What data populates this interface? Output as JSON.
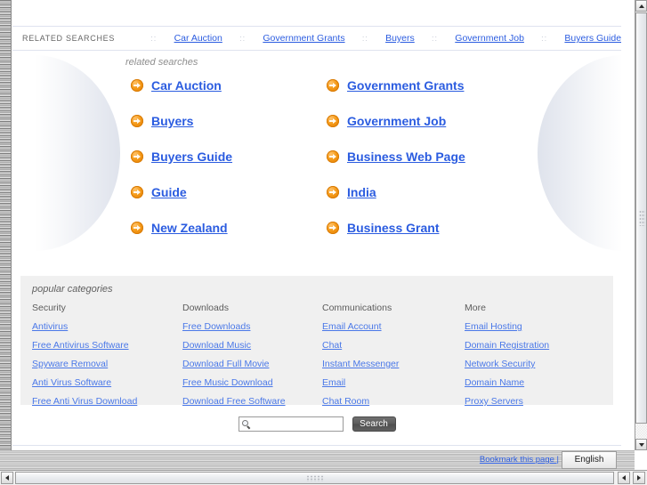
{
  "top_strip": {
    "label": "RELATED SEARCHES",
    "separator": "::",
    "links": [
      "Car Auction",
      "Government Grants",
      "Buyers",
      "Government Job",
      "Buyers Guide"
    ]
  },
  "related_searches": {
    "heading": "related searches",
    "items": [
      "Car Auction",
      "Government Grants",
      "Buyers",
      "Government Job",
      "Buyers Guide",
      "Business Web Page",
      "Guide",
      "India",
      "New Zealand",
      "Business Grant"
    ],
    "arrow_icon": "arrow-circle-right-icon"
  },
  "popular_categories": {
    "heading": "popular categories",
    "columns": [
      {
        "title": "Security",
        "links": [
          "Antivirus",
          "Free Antivirus Software",
          "Spyware Removal",
          "Anti Virus Software",
          "Free Anti Virus Download"
        ]
      },
      {
        "title": "Downloads",
        "links": [
          "Free Downloads",
          "Download Music",
          "Download Full Movie",
          "Free Music Download",
          "Download Free Software"
        ]
      },
      {
        "title": "Communications",
        "links": [
          "Email Account",
          "Chat",
          "Instant Messenger",
          "Email",
          "Chat Room"
        ]
      },
      {
        "title": "More",
        "links": [
          "Email Hosting",
          "Domain Registration",
          "Network Security",
          "Domain Name",
          "Proxy Servers"
        ]
      }
    ]
  },
  "search": {
    "value": "",
    "placeholder": "",
    "button_label": "Search",
    "icon": "magnifier-icon"
  },
  "bottom_bar": {
    "bookmark_label": "Bookmark this page |",
    "language": "English"
  },
  "colors": {
    "link": "#2b5ce0",
    "category_link": "#4a78e8",
    "arrow_orange": "#f59a18",
    "panel_bg": "#f0f0f0",
    "rule": "#dfe3ef"
  }
}
